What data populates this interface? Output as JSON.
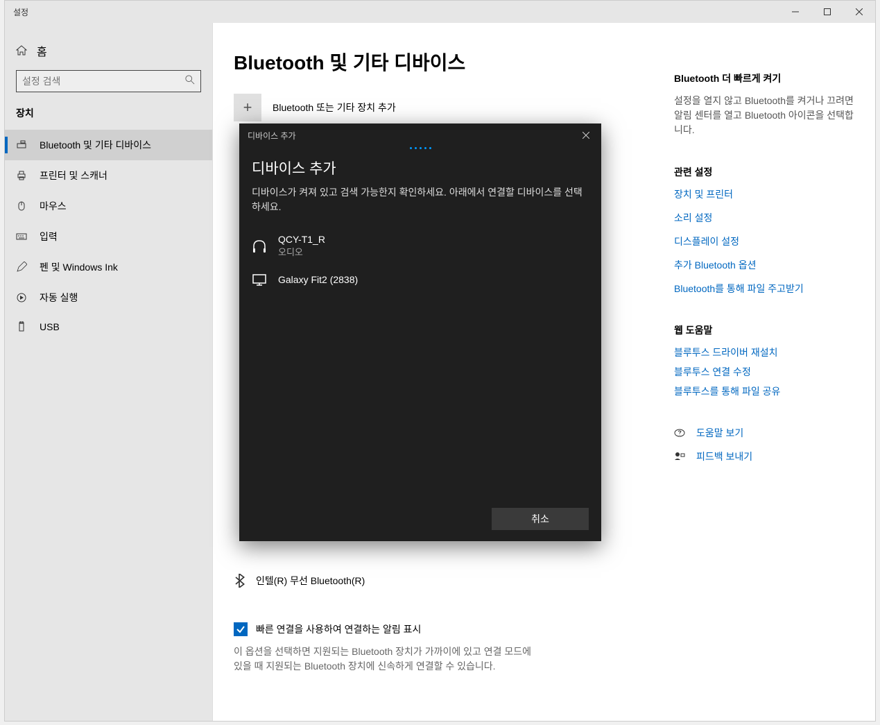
{
  "window": {
    "title": "설정"
  },
  "titlebar_controls": {
    "min": "−",
    "max": "□",
    "close": "✕"
  },
  "sidebar": {
    "home": "홈",
    "search_placeholder": "설정 검색",
    "section": "장치",
    "items": [
      "Bluetooth 및 기타 디바이스",
      "프린터 및 스캐너",
      "마우스",
      "입력",
      "펜 및 Windows Ink",
      "자동 실행",
      "USB"
    ]
  },
  "page": {
    "title": "Bluetooth 및 기타 디바이스",
    "add_label": "Bluetooth 또는 기타 장치 추가",
    "device_intel": "인텔(R) 무선 Bluetooth(R)",
    "checkbox_label": "빠른 연결을 사용하여 연결하는 알림 표시",
    "desc": "이 옵션을 선택하면 지원되는 Bluetooth 장치가 가까이에 있고 연결 모드에 있을 때 지원되는 Bluetooth 장치에 신속하게 연결할 수 있습니다."
  },
  "right": {
    "faster_heading": "Bluetooth 더 빠르게 켜기",
    "faster_text": "설정을 열지 않고 Bluetooth를 켜거나 끄려면 알림 센터를 열고 Bluetooth 아이콘을 선택합니다.",
    "related_heading": "관련 설정",
    "links": [
      "장치 및 프린터",
      "소리 설정",
      "디스플레이 설정",
      "추가 Bluetooth 옵션",
      "Bluetooth를 통해 파일 주고받기"
    ],
    "webhelp_heading": "웹 도움말",
    "weblinks": [
      "블루투스 드라이버 재설치",
      "블루투스 연결 수정",
      "블루투스를 통해 파일 공유"
    ],
    "help_label": "도움말 보기",
    "feedback_label": "피드백 보내기"
  },
  "dialog": {
    "title": "디바이스 추가",
    "heading": "디바이스 추가",
    "desc": "디바이스가 켜져 있고 검색 가능한지 확인하세요. 아래에서 연결할 디바이스를 선택하세요.",
    "devices": [
      {
        "name": "QCY-T1_R",
        "sub": "오디오"
      },
      {
        "name": "Galaxy Fit2 (2838)",
        "sub": ""
      }
    ],
    "cancel": "취소"
  }
}
